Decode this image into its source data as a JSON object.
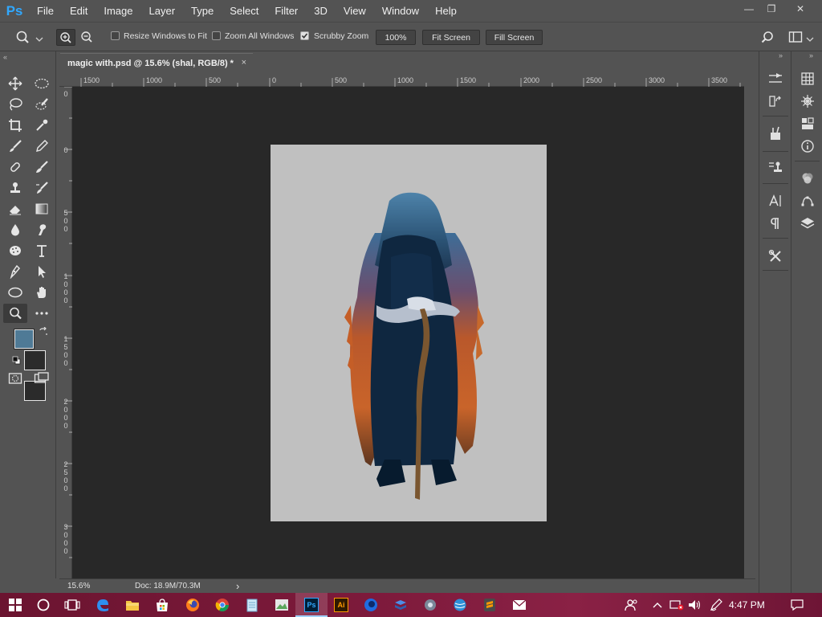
{
  "app": {
    "logo": "Ps"
  },
  "menu": [
    "File",
    "Edit",
    "Image",
    "Layer",
    "Type",
    "Select",
    "Filter",
    "3D",
    "View",
    "Window",
    "Help"
  ],
  "window_controls": {
    "minimize": "—",
    "restore": "❐",
    "close": "✕"
  },
  "options": {
    "resize_windows_label": "Resize Windows to Fit",
    "resize_windows_checked": false,
    "zoom_all_label": "Zoom All Windows",
    "zoom_all_checked": false,
    "scrubby_zoom_label": "Scrubby Zoom",
    "scrubby_zoom_checked": true,
    "zoom_percent_button": "100%",
    "fit_screen_button": "Fit Screen",
    "fill_screen_button": "Fill Screen"
  },
  "document_tab": {
    "title": "magic with.psd @ 15.6% (shal, RGB/8) *",
    "close": "×"
  },
  "ruler_h_labels": [
    "1500",
    "1000",
    "500",
    "0",
    "500",
    "1000",
    "1500",
    "2000",
    "2500",
    "3000",
    "3500"
  ],
  "ruler_v_labels": [
    "0",
    "0",
    "500",
    "1000",
    "1500",
    "2000",
    "2500",
    "3000"
  ],
  "status": {
    "zoom": "15.6%",
    "doc_info": "Doc: 18.9M/70.3M",
    "arrow": "›"
  },
  "colors": {
    "foreground": "#4f7a96",
    "background": "#2b2b2b",
    "canvas_bg": "#282828",
    "document_bg": "#c0c0c0",
    "accent": "#31a8ff"
  },
  "taskbar": {
    "time": "4:47 PM"
  },
  "tools": [
    "move-tool",
    "marquee-ellipse-tool",
    "lasso-tool",
    "quick-selection-tool",
    "crop-tool",
    "eyedropper-tool",
    "brush-tool",
    "pencil-tool",
    "healing-brush-tool",
    "history-brush-tool",
    "clone-stamp-tool",
    "art-history-brush-tool",
    "eraser-tool",
    "gradient-tool",
    "blur-tool",
    "smudge-tool",
    "sponge-tool",
    "type-tool",
    "pen-tool",
    "path-selection-tool",
    "ellipse-shape-tool",
    "rotate-view-tool",
    "zoom-tool",
    "more-tools"
  ]
}
